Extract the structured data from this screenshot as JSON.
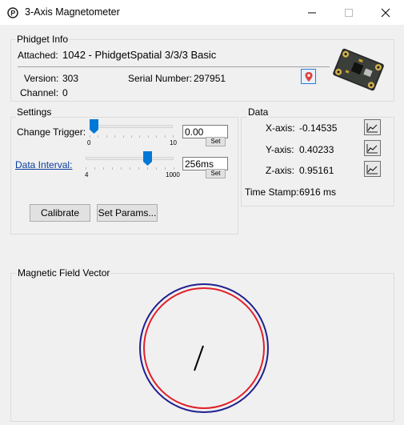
{
  "window": {
    "title": "3-Axis Magnetometer"
  },
  "phidget_info": {
    "legend": "Phidget Info",
    "attached_label": "Attached:",
    "attached_value": "1042 - PhidgetSpatial 3/3/3 Basic",
    "version_label": "Version:",
    "version_value": "303",
    "serial_label": "Serial Number:",
    "serial_value": "297951",
    "channel_label": "Channel:",
    "channel_value": "0"
  },
  "settings": {
    "legend": "Settings",
    "change_trigger_label": "Change Trigger:",
    "change_trigger_min": "0",
    "change_trigger_max": "10",
    "change_trigger_value": "0.00",
    "change_trigger_slider_fraction": 0.0,
    "data_interval_label": "Data Interval:",
    "data_interval_min": "4",
    "data_interval_max": "1000",
    "data_interval_value": "256ms",
    "data_interval_slider_fraction": 0.7,
    "set_label": "Set",
    "calibrate_label": "Calibrate",
    "set_params_label": "Set Params..."
  },
  "data": {
    "legend": "Data",
    "x_label": "X-axis:",
    "x_value": "-0.14535",
    "y_label": "Y-axis:",
    "y_value": "0.40233",
    "z_label": "Z-axis:",
    "z_value": "0.95161",
    "timestamp_label": "Time Stamp:",
    "timestamp_value": "6916 ms"
  },
  "vector": {
    "legend": "Magnetic Field Vector",
    "outer_circle_color": "#1f1f8f",
    "inner_circle_color": "#e0202a",
    "needle_color": "#000000"
  },
  "colors": {
    "slider_thumb": "#0078d7",
    "link": "#0b3c9e"
  }
}
